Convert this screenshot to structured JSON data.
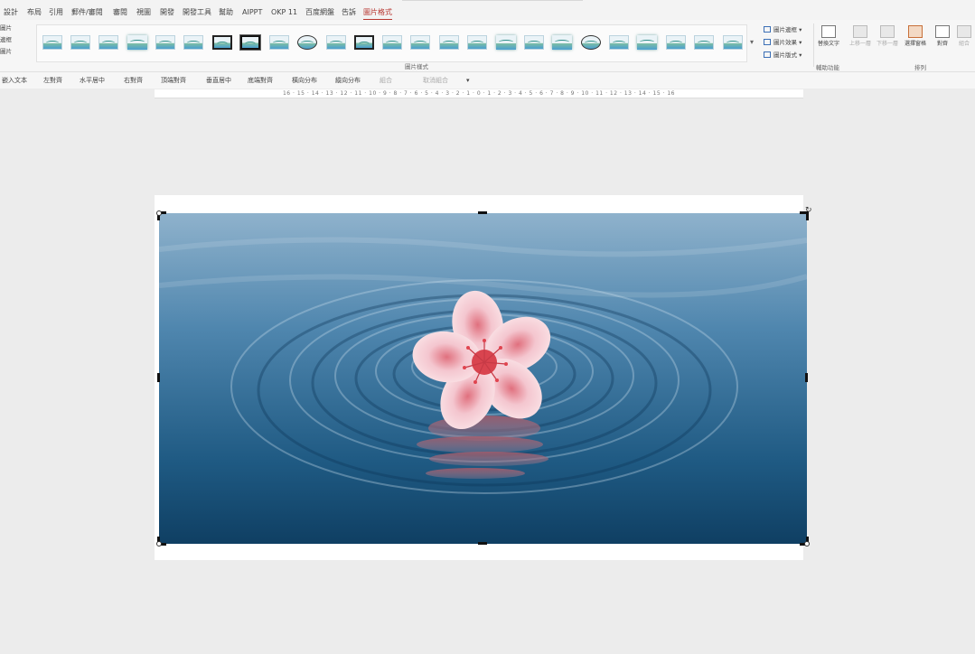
{
  "menu": {
    "tabs": [
      {
        "label": "設計"
      },
      {
        "label": "布局"
      },
      {
        "label": "引用"
      },
      {
        "label": "郵件/審閱"
      },
      {
        "label": "審閱"
      },
      {
        "label": "視圖"
      },
      {
        "label": "開發"
      },
      {
        "label": "開發工具"
      },
      {
        "label": "幫助"
      },
      {
        "label": "AIPPT"
      },
      {
        "label": "OKP 11"
      },
      {
        "label": "百度網盤"
      },
      {
        "label": "告訴"
      },
      {
        "label": "圖片格式"
      }
    ],
    "active_tab": "圖片格式"
  },
  "ribbon": {
    "left_items": [
      "圖片",
      "邊框",
      "圖片"
    ],
    "gallery_label": "圖片樣式",
    "gallery_scroll_icon": "chevron-down-icon",
    "picture_options": [
      "圖片邊框",
      "圖片效果",
      "圖片版式"
    ],
    "buttons": [
      {
        "label": "替換文字",
        "group": "輔助功能"
      },
      {
        "label": "上移一層"
      },
      {
        "label": "下移一層"
      },
      {
        "label": "選擇窗格"
      },
      {
        "label": "對齊"
      },
      {
        "label": "組合"
      }
    ],
    "group_labels": {
      "accessibility": "輔助功能",
      "arrange": "排列"
    }
  },
  "arrange_bar": {
    "items": [
      {
        "label": "嵌入文本",
        "enabled": true
      },
      {
        "label": "左對齊",
        "enabled": true
      },
      {
        "label": "水平居中",
        "enabled": true
      },
      {
        "label": "右對齊",
        "enabled": true
      },
      {
        "label": "頂端對齊",
        "enabled": true
      },
      {
        "label": "垂直居中",
        "enabled": true
      },
      {
        "label": "底端對齊",
        "enabled": true
      },
      {
        "label": "橫向分布",
        "enabled": true
      },
      {
        "label": "縱向分布",
        "enabled": true
      },
      {
        "label": "組合",
        "enabled": false
      },
      {
        "label": "取消組合",
        "enabled": false
      }
    ],
    "more_icon": "chevron-down-icon"
  },
  "ruler": {
    "text": "16 · 15 · 14 · 13 · 12 · 11 · 10 · 9 · 8 · 7 · 6 · 5 · 4 · 3 · 2 · 1 · 0 · 1 · 2 · 3 · 4 · 5 · 6 · 7 · 8 · 9 · 10 · 11 · 12 · 13 · 14 · 15 · 16"
  },
  "document": {
    "image_subject": "pink flower floating on blue water ripples",
    "selected": true
  },
  "colors": {
    "accent": "#b7352f",
    "water_dark": "#0f3f63",
    "water_light": "#8fb2cc",
    "petal": "#f4c6cf"
  }
}
